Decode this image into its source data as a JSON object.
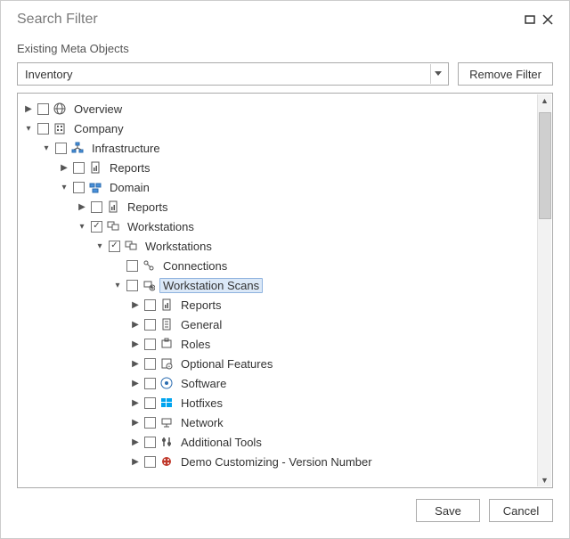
{
  "title": "Search Filter",
  "section_label": "Existing Meta Objects",
  "combo": {
    "value": "Inventory"
  },
  "remove_filter_label": "Remove Filter",
  "save_label": "Save",
  "cancel_label": "Cancel",
  "tree": {
    "overview": "Overview",
    "company": "Company",
    "infrastructure": "Infrastructure",
    "reports1": "Reports",
    "domain": "Domain",
    "reports2": "Reports",
    "workstations1": "Workstations",
    "workstations2": "Workstations",
    "connections": "Connections",
    "workstation_scans": "Workstation Scans",
    "reports3": "Reports",
    "general": "General",
    "roles": "Roles",
    "optional_features": "Optional Features",
    "software": "Software",
    "hotfixes": "Hotfixes",
    "network": "Network",
    "additional_tools": "Additional Tools",
    "demo_customizing": "Demo Customizing - Version Number"
  }
}
